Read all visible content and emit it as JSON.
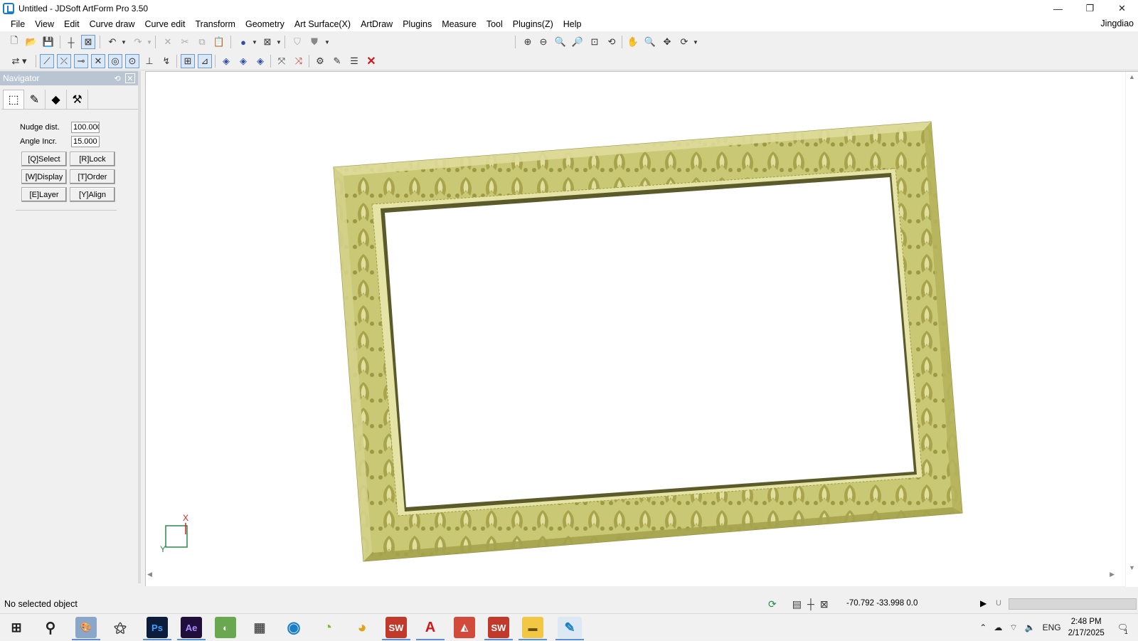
{
  "window": {
    "title": "Untitled - JDSoft ArtForm Pro 3.50",
    "minimize": "—",
    "restore": "❐",
    "close": "✕"
  },
  "menu": {
    "items": [
      "File",
      "View",
      "Edit",
      "Curve draw",
      "Curve edit",
      "Transform",
      "Geometry",
      "Art Surface(X)",
      "ArtDraw",
      "Plugins",
      "Measure",
      "Tool",
      "Plugins(Z)",
      "Help"
    ],
    "user": "Jingdiao"
  },
  "toolbar1": {
    "icons": [
      "new-icon",
      "open-icon",
      "save-icon",
      "snap-point-icon",
      "snap-grid-icon",
      "undo-icon",
      "redo-icon",
      "delete-icon",
      "cut-icon",
      "copy-icon",
      "paste-icon",
      "render-sphere-icon",
      "view-box-icon",
      "shade-icon",
      "shade-dark-icon",
      "zoom-window-icon",
      "zoom-out-icon",
      "zoom-in-icon",
      "zoom-realtime-icon",
      "zoom-extents-icon",
      "zoom-previous-icon",
      "pan-icon",
      "zoom-dynamic-icon",
      "move-view-icon",
      "rotate-view-icon"
    ]
  },
  "toolbar2": {
    "icons": [
      "select-mode-icon",
      "line-icon",
      "trim-icon",
      "extend-icon",
      "intersect-icon",
      "circle-icon",
      "ellipse-icon",
      "dimension-icon",
      "fillet-icon",
      "grid-icon",
      "measure-icon",
      "surface-a-icon",
      "surface-b-icon",
      "surface-c-icon",
      "node-edit-icon",
      "node-delete-icon",
      "wrap-icon",
      "curve-tool-icon",
      "list-icon",
      "close-red-icon"
    ]
  },
  "navigator": {
    "title": "Navigator",
    "tabs": [
      "object-tab-icon",
      "draw-tab-icon",
      "layer-tab-icon",
      "tool-tab-icon"
    ],
    "nudge_label": "Nudge dist.",
    "nudge_value": "100.000",
    "angle_label": "Angle Incr.",
    "angle_value": "15.000",
    "buttons": [
      "[Q]Select",
      "[R]Lock",
      "[W]Display",
      "[T]Order",
      "[E]Layer",
      "[Y]Align"
    ]
  },
  "viewport": {
    "axis_x": "X",
    "axis_y": "Y",
    "frame_color": "#c8c77a",
    "frame_shadow": "#5e5b2c"
  },
  "status": {
    "text": "No selected object",
    "coords": "-70.792 -33.998 0.0",
    "u_label": "U"
  },
  "taskbar": {
    "apps": [
      "Ps",
      "Ae",
      "SW",
      "A",
      "SW"
    ],
    "lang": "ENG",
    "time": "2:48 PM",
    "date": "2/17/2025",
    "notif_count": "1"
  }
}
